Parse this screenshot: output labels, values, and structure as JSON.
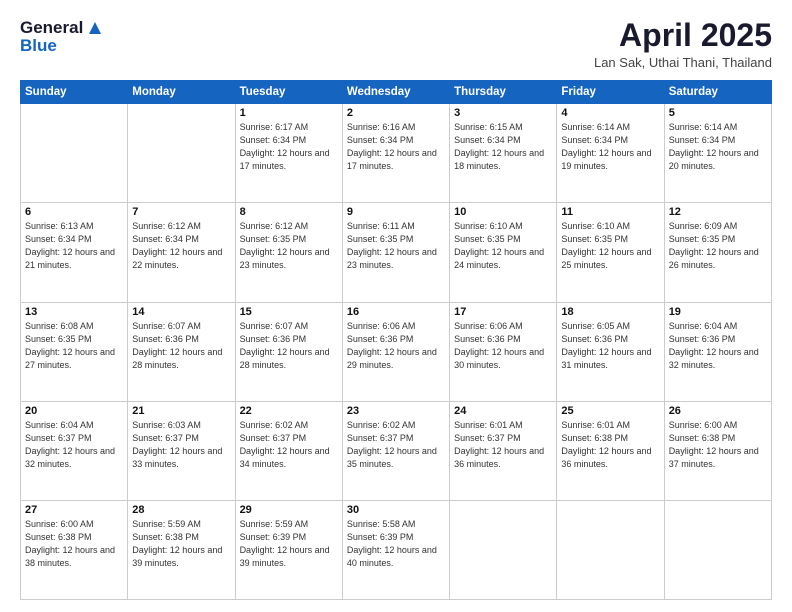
{
  "header": {
    "logo_general": "General",
    "logo_blue": "Blue",
    "month_title": "April 2025",
    "location": "Lan Sak, Uthai Thani, Thailand"
  },
  "days_of_week": [
    "Sunday",
    "Monday",
    "Tuesday",
    "Wednesday",
    "Thursday",
    "Friday",
    "Saturday"
  ],
  "weeks": [
    [
      {
        "day": "",
        "info": ""
      },
      {
        "day": "",
        "info": ""
      },
      {
        "day": "1",
        "info": "Sunrise: 6:17 AM\nSunset: 6:34 PM\nDaylight: 12 hours and 17 minutes."
      },
      {
        "day": "2",
        "info": "Sunrise: 6:16 AM\nSunset: 6:34 PM\nDaylight: 12 hours and 17 minutes."
      },
      {
        "day": "3",
        "info": "Sunrise: 6:15 AM\nSunset: 6:34 PM\nDaylight: 12 hours and 18 minutes."
      },
      {
        "day": "4",
        "info": "Sunrise: 6:14 AM\nSunset: 6:34 PM\nDaylight: 12 hours and 19 minutes."
      },
      {
        "day": "5",
        "info": "Sunrise: 6:14 AM\nSunset: 6:34 PM\nDaylight: 12 hours and 20 minutes."
      }
    ],
    [
      {
        "day": "6",
        "info": "Sunrise: 6:13 AM\nSunset: 6:34 PM\nDaylight: 12 hours and 21 minutes."
      },
      {
        "day": "7",
        "info": "Sunrise: 6:12 AM\nSunset: 6:34 PM\nDaylight: 12 hours and 22 minutes."
      },
      {
        "day": "8",
        "info": "Sunrise: 6:12 AM\nSunset: 6:35 PM\nDaylight: 12 hours and 23 minutes."
      },
      {
        "day": "9",
        "info": "Sunrise: 6:11 AM\nSunset: 6:35 PM\nDaylight: 12 hours and 23 minutes."
      },
      {
        "day": "10",
        "info": "Sunrise: 6:10 AM\nSunset: 6:35 PM\nDaylight: 12 hours and 24 minutes."
      },
      {
        "day": "11",
        "info": "Sunrise: 6:10 AM\nSunset: 6:35 PM\nDaylight: 12 hours and 25 minutes."
      },
      {
        "day": "12",
        "info": "Sunrise: 6:09 AM\nSunset: 6:35 PM\nDaylight: 12 hours and 26 minutes."
      }
    ],
    [
      {
        "day": "13",
        "info": "Sunrise: 6:08 AM\nSunset: 6:35 PM\nDaylight: 12 hours and 27 minutes."
      },
      {
        "day": "14",
        "info": "Sunrise: 6:07 AM\nSunset: 6:36 PM\nDaylight: 12 hours and 28 minutes."
      },
      {
        "day": "15",
        "info": "Sunrise: 6:07 AM\nSunset: 6:36 PM\nDaylight: 12 hours and 28 minutes."
      },
      {
        "day": "16",
        "info": "Sunrise: 6:06 AM\nSunset: 6:36 PM\nDaylight: 12 hours and 29 minutes."
      },
      {
        "day": "17",
        "info": "Sunrise: 6:06 AM\nSunset: 6:36 PM\nDaylight: 12 hours and 30 minutes."
      },
      {
        "day": "18",
        "info": "Sunrise: 6:05 AM\nSunset: 6:36 PM\nDaylight: 12 hours and 31 minutes."
      },
      {
        "day": "19",
        "info": "Sunrise: 6:04 AM\nSunset: 6:36 PM\nDaylight: 12 hours and 32 minutes."
      }
    ],
    [
      {
        "day": "20",
        "info": "Sunrise: 6:04 AM\nSunset: 6:37 PM\nDaylight: 12 hours and 32 minutes."
      },
      {
        "day": "21",
        "info": "Sunrise: 6:03 AM\nSunset: 6:37 PM\nDaylight: 12 hours and 33 minutes."
      },
      {
        "day": "22",
        "info": "Sunrise: 6:02 AM\nSunset: 6:37 PM\nDaylight: 12 hours and 34 minutes."
      },
      {
        "day": "23",
        "info": "Sunrise: 6:02 AM\nSunset: 6:37 PM\nDaylight: 12 hours and 35 minutes."
      },
      {
        "day": "24",
        "info": "Sunrise: 6:01 AM\nSunset: 6:37 PM\nDaylight: 12 hours and 36 minutes."
      },
      {
        "day": "25",
        "info": "Sunrise: 6:01 AM\nSunset: 6:38 PM\nDaylight: 12 hours and 36 minutes."
      },
      {
        "day": "26",
        "info": "Sunrise: 6:00 AM\nSunset: 6:38 PM\nDaylight: 12 hours and 37 minutes."
      }
    ],
    [
      {
        "day": "27",
        "info": "Sunrise: 6:00 AM\nSunset: 6:38 PM\nDaylight: 12 hours and 38 minutes."
      },
      {
        "day": "28",
        "info": "Sunrise: 5:59 AM\nSunset: 6:38 PM\nDaylight: 12 hours and 39 minutes."
      },
      {
        "day": "29",
        "info": "Sunrise: 5:59 AM\nSunset: 6:39 PM\nDaylight: 12 hours and 39 minutes."
      },
      {
        "day": "30",
        "info": "Sunrise: 5:58 AM\nSunset: 6:39 PM\nDaylight: 12 hours and 40 minutes."
      },
      {
        "day": "",
        "info": ""
      },
      {
        "day": "",
        "info": ""
      },
      {
        "day": "",
        "info": ""
      }
    ]
  ]
}
